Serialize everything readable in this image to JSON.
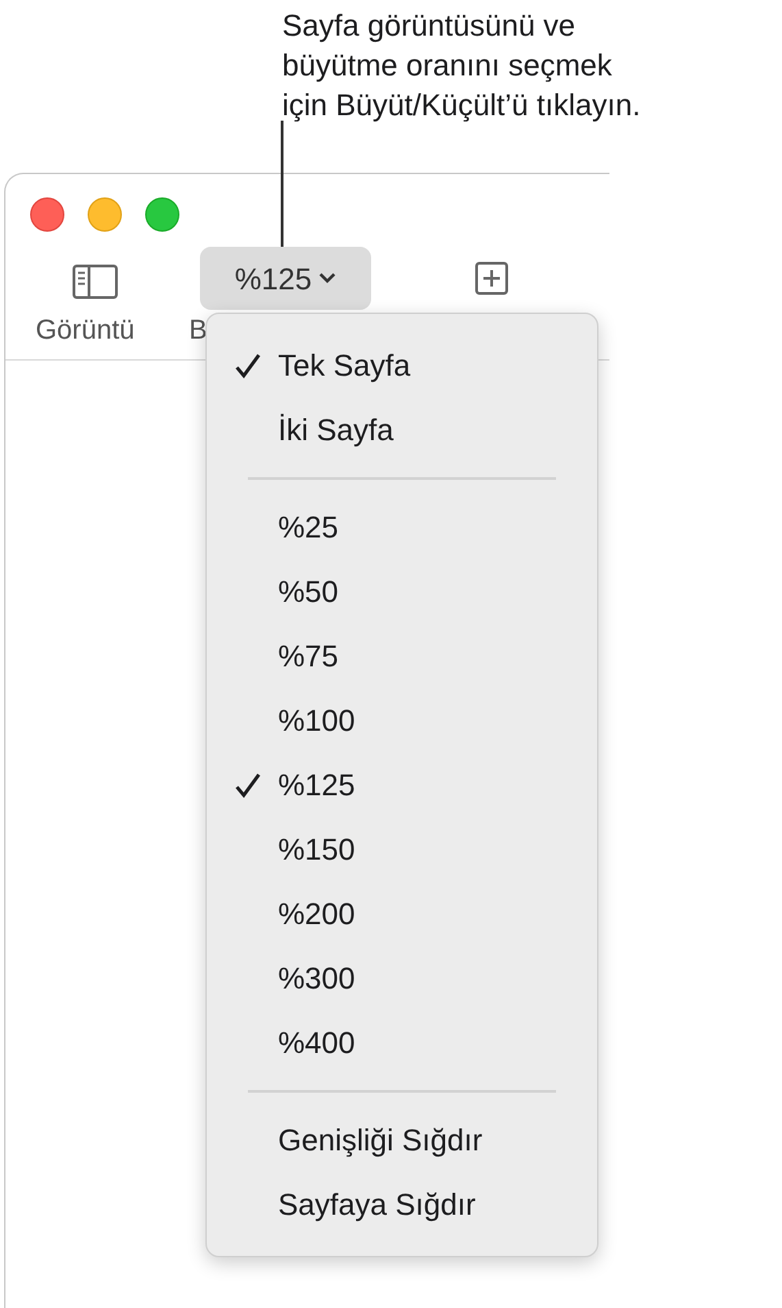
{
  "callout": {
    "lines": [
      "Sayfa görüntüsünü ve",
      "büyütme oranını seçmek",
      "için Büyüt/Küçült’ü tıklayın."
    ]
  },
  "toolbar": {
    "view_button": {
      "label": "Görüntü"
    },
    "zoom_button": {
      "value": "%125",
      "expanded": true
    },
    "column_2_label": "B"
  },
  "zoom_menu": [
    {
      "kind": "item",
      "label": "Tek Sayfa",
      "checked": true
    },
    {
      "kind": "item",
      "label": "İki Sayfa",
      "checked": false
    },
    {
      "kind": "separator"
    },
    {
      "kind": "item",
      "label": "%25",
      "checked": false
    },
    {
      "kind": "item",
      "label": "%50",
      "checked": false
    },
    {
      "kind": "item",
      "label": "%75",
      "checked": false
    },
    {
      "kind": "item",
      "label": "%100",
      "checked": false
    },
    {
      "kind": "item",
      "label": "%125",
      "checked": true
    },
    {
      "kind": "item",
      "label": "%150",
      "checked": false
    },
    {
      "kind": "item",
      "label": "%200",
      "checked": false
    },
    {
      "kind": "item",
      "label": "%300",
      "checked": false
    },
    {
      "kind": "item",
      "label": "%400",
      "checked": false
    },
    {
      "kind": "separator"
    },
    {
      "kind": "item",
      "label": "Genişliği Sığdır",
      "checked": false
    },
    {
      "kind": "item",
      "label": "Sayfaya Sığdır",
      "checked": false
    }
  ]
}
